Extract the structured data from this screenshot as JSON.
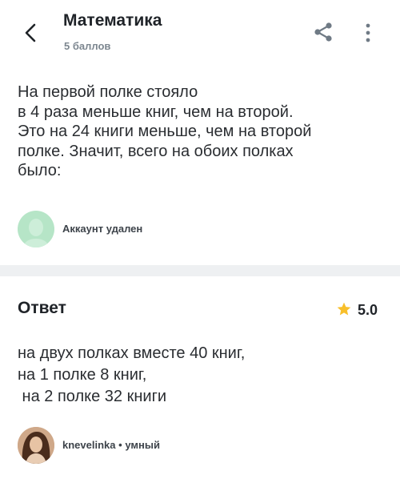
{
  "header": {
    "subject": "Математика",
    "points": "5 баллов",
    "icons": {
      "back": "chevron-left-icon",
      "share": "share-icon",
      "more": "more-vertical-icon"
    }
  },
  "question": {
    "lines": [
      "На первой полке стояло",
      "в 4 раза меньше книг, чем на второй.",
      "Это на 24 книги меньше, чем на второй",
      "полке. Значит, всего на обоих полках",
      "было:"
    ],
    "author": "Аккаунт удален"
  },
  "answer": {
    "title": "Ответ",
    "rating": "5.0",
    "lines": [
      "на двух полках вместе 40 книг,",
      "на 1 полке 8 книг,",
      " на 2 полке 32 книги"
    ],
    "author": "knevelinka",
    "separator": "•",
    "rank": "умный"
  },
  "colors": {
    "accent_star": "#f8bf2a",
    "deleted_avatar": "#b6e5c7",
    "divider": "#eef0f2",
    "muted_text": "#7d8790"
  }
}
